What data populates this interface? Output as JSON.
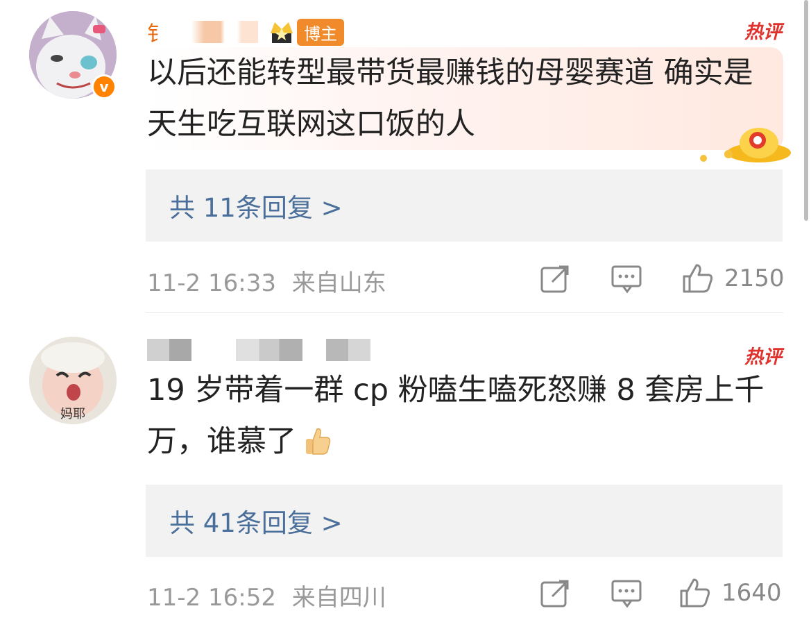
{
  "comments": [
    {
      "username": "钅",
      "role_badge": "博主",
      "hot_label": "热评",
      "content": "以后还能转型最带货最赚钱的母婴赛道 确实是天生吃互联网这口饭的人",
      "replies_label": "共 11条回复 >",
      "time": "11-2 16:33",
      "location": "来自山东",
      "likes": "2150"
    },
    {
      "avatar_text": "妈耶",
      "hot_label": "热评",
      "content": "19 岁带着一群 cp 粉嗑生嗑死怒赚 8 套房上千万，谁慕了",
      "replies_label": "共 41条回复 >",
      "time": "11-2 16:52",
      "location": "来自四川",
      "likes": "1640"
    }
  ],
  "icons": {
    "repost": "repost-icon",
    "comment": "comment-icon",
    "like": "thumbs-up-icon",
    "verified": "verified-v-icon",
    "thumbs_emoji": "thumbs-up-emoji"
  },
  "colors": {
    "hot": "#e0322d",
    "username": "#e86a10",
    "reply_link": "#4a6f9a",
    "meta": "#999999"
  }
}
